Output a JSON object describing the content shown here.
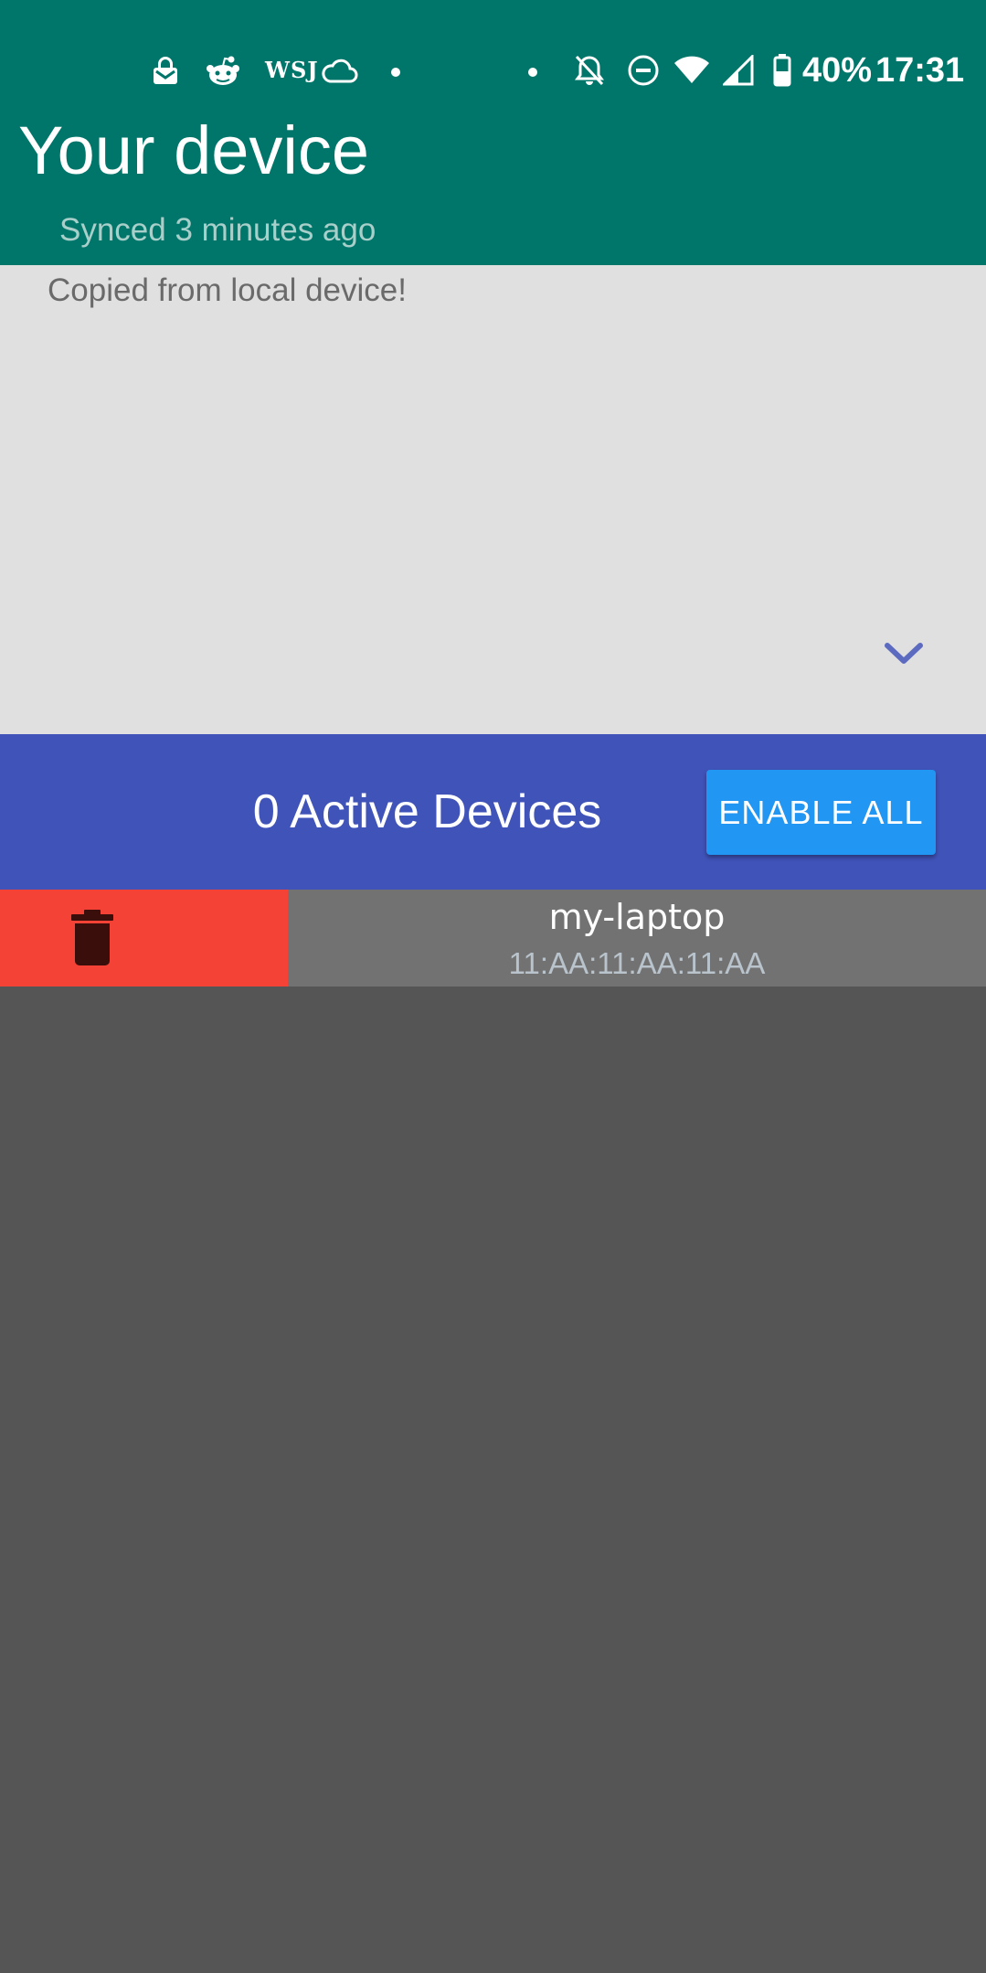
{
  "status_bar": {
    "notification_icons": [
      "lock-mail-icon",
      "reddit-icon",
      "wsj-icon",
      "cloud-icon"
    ],
    "wsj_label": "WSJ",
    "system_icons": [
      "notifications-off-icon",
      "do-not-disturb-icon",
      "wifi-icon",
      "cell-signal-icon",
      "battery-icon"
    ],
    "battery_percent": "40%",
    "time": "17:31"
  },
  "header": {
    "title": "Your device",
    "sync_status": "Synced 3 minutes ago"
  },
  "clipboard": {
    "content": "Copied from local device!",
    "expand_icon": "chevron-down-icon"
  },
  "devices_bar": {
    "active_count_label": "0 Active Devices",
    "enable_all_label": "ENABLE ALL"
  },
  "devices": [
    {
      "name": "my-laptop",
      "mac": "11:AA:11:AA:11:AA"
    }
  ],
  "colors": {
    "header_bg": "#00766b",
    "clipboard_bg": "#e0e0e0",
    "devices_bar_bg": "#4053b9",
    "enable_button_bg": "#2196f3",
    "delete_bg": "#f44336",
    "device_row_bg": "#727272",
    "page_bg": "#555555"
  }
}
